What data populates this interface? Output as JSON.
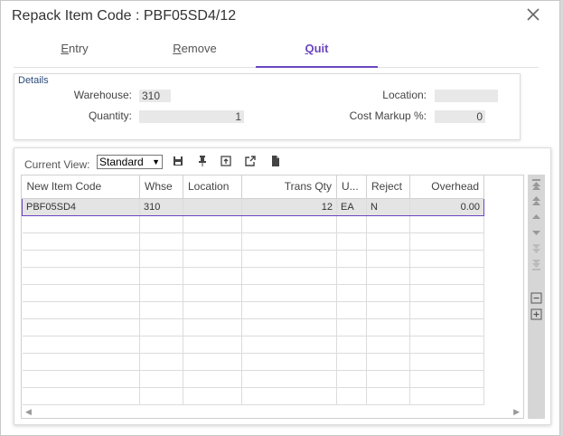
{
  "window": {
    "title": "Repack Item Code : PBF05SD4/12"
  },
  "tabs": [
    {
      "prefix": "",
      "accel": "E",
      "rest": "ntry"
    },
    {
      "prefix": "",
      "accel": "R",
      "rest": "emove"
    },
    {
      "prefix": "",
      "accel": "Q",
      "rest": "uit"
    }
  ],
  "details": {
    "label": "Details",
    "warehouse_label": "Warehouse:",
    "warehouse_value": "310",
    "quantity_label": "Quantity:",
    "quantity_value": "1",
    "location_label": "Location:",
    "location_value": "",
    "markup_label": "Cost Markup %:",
    "markup_value": "0"
  },
  "grid": {
    "current_view_label": "Current View:",
    "current_view_value": "Standard",
    "columns": [
      "New Item Code",
      "Whse",
      "Location",
      "Trans Qty",
      "U...",
      "Reject",
      "Overhead"
    ],
    "rows": [
      [
        "PBF05SD4",
        "310",
        "",
        "12",
        "EA",
        "N",
        "0.00"
      ]
    ],
    "empty_rows": 11
  },
  "toolbar_icons": [
    "save-icon",
    "pin-icon",
    "export-icon",
    "open-external-icon",
    "document-icon"
  ],
  "rail_icons": [
    "first-icon",
    "previous-page-icon",
    "previous-icon",
    "next-icon",
    "next-page-icon",
    "last-icon",
    "collapse-icon",
    "expand-icon"
  ],
  "colors": {
    "accent": "#6b46c1",
    "field_bg": "#e8e8e8",
    "label_blue": "#2a4a7a"
  }
}
